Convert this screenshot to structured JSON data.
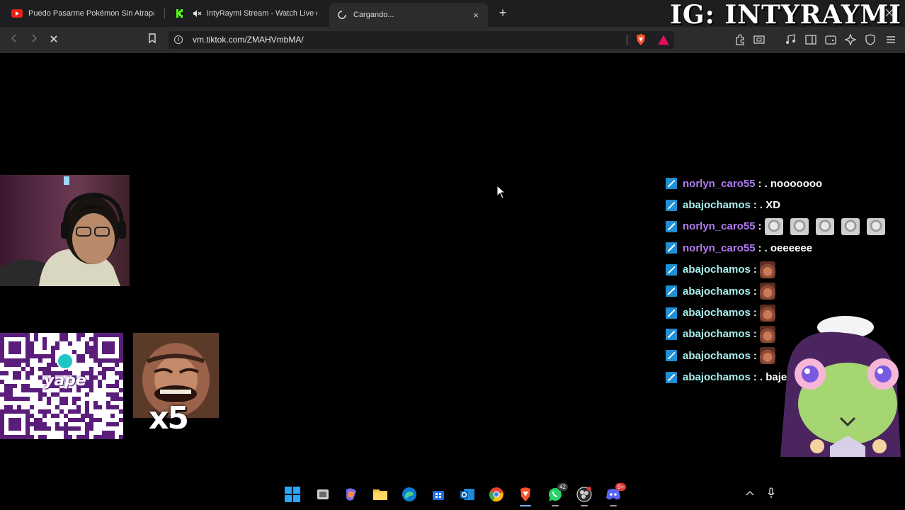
{
  "browser": {
    "tabs": [
      {
        "label": "Puedo Pasarme Pokémon Sin Atrapar",
        "favicon": "youtube-icon",
        "active": false
      },
      {
        "label": "IntyRaymi Stream - Watch Live on",
        "favicon": "kick-icon",
        "muted": true,
        "active": false
      },
      {
        "label": "Cargando...",
        "favicon": "loading-spinner-icon",
        "active": true
      }
    ],
    "new_tab": "+",
    "close_tab": "×",
    "url": "vm.tiktok.com/ZMAHVmbMA/"
  },
  "overlay": {
    "instagram_handle": "IG: INTYRAYMI",
    "chat": [
      {
        "user": "norlyn_caro55",
        "color": "#b07cf0",
        "text": ". nooooooo",
        "emotes": 0
      },
      {
        "user": "abajochamos",
        "color": "#a8f0ee",
        "text": ". XD",
        "emotes": 0
      },
      {
        "user": "norlyn_caro55",
        "color": "#b07cf0",
        "text": "",
        "emotes": 5,
        "emote_type": "grey"
      },
      {
        "user": "norlyn_caro55",
        "color": "#b07cf0",
        "text": ". oeeeeee",
        "emotes": 0
      },
      {
        "user": "abajochamos",
        "color": "#a8f0ee",
        "text": "",
        "emotes": 1,
        "emote_type": "face"
      },
      {
        "user": "abajochamos",
        "color": "#a8f0ee",
        "text": "",
        "emotes": 1,
        "emote_type": "face"
      },
      {
        "user": "abajochamos",
        "color": "#a8f0ee",
        "text": "",
        "emotes": 1,
        "emote_type": "face"
      },
      {
        "user": "abajochamos",
        "color": "#a8f0ee",
        "text": "",
        "emotes": 1,
        "emote_type": "face"
      },
      {
        "user": "abajochamos",
        "color": "#a8f0ee",
        "text": "",
        "emotes": 1,
        "emote_type": "face"
      },
      {
        "user": "abajochamos",
        "color": "#a8f0ee",
        "text": ". baje",
        "emotes": 0
      }
    ],
    "donation_brand": "yape",
    "emote_multiplier": "x5"
  },
  "taskbar": {
    "whatsapp_badge": "42",
    "discord_badge": "9+"
  }
}
